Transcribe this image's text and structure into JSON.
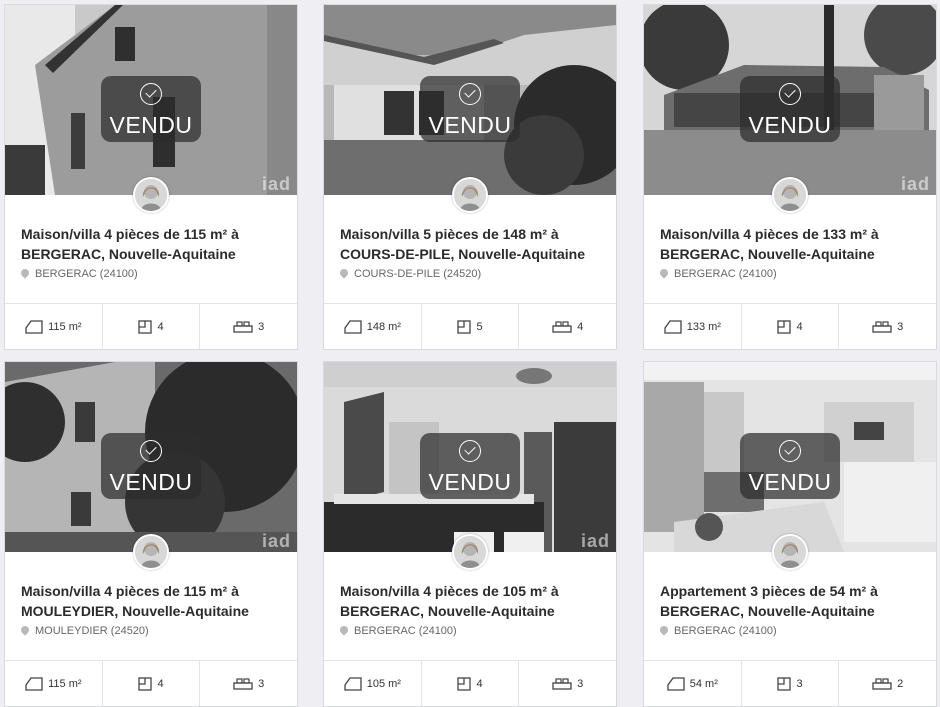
{
  "sold_label": "VENDU",
  "watermark": "iad",
  "listings": [
    {
      "title": "Maison/villa 4 pièces de 115 m² à BERGERAC, Nouvelle-Aquitaine",
      "location": "BERGERAC (24100)",
      "surface": "115 m²",
      "rooms": "4",
      "bedrooms": "3",
      "watermark": "iad"
    },
    {
      "title": "Maison/villa 5 pièces de 148 m² à COURS-DE-PILE, Nouvelle-Aquitaine",
      "location": "COURS-DE-PILE (24520)",
      "surface": "148 m²",
      "rooms": "5",
      "bedrooms": "4",
      "watermark": ""
    },
    {
      "title": "Maison/villa 4 pièces de 133 m² à BERGERAC, Nouvelle-Aquitaine",
      "location": "BERGERAC (24100)",
      "surface": "133 m²",
      "rooms": "4",
      "bedrooms": "3",
      "watermark": "iad"
    },
    {
      "title": "Maison/villa 4 pièces de 115 m² à MOULEYDIER, Nouvelle-Aquitaine",
      "location": "MOULEYDIER (24520)",
      "surface": "115 m²",
      "rooms": "4",
      "bedrooms": "3",
      "watermark": "iad"
    },
    {
      "title": "Maison/villa 4 pièces de 105 m² à BERGERAC, Nouvelle-Aquitaine",
      "location": "BERGERAC (24100)",
      "surface": "105 m²",
      "rooms": "4",
      "bedrooms": "3",
      "watermark": "iad"
    },
    {
      "title": "Appartement 3 pièces de 54 m² à BERGERAC, Nouvelle-Aquitaine",
      "location": "BERGERAC (24100)",
      "surface": "54 m²",
      "rooms": "3",
      "bedrooms": "2",
      "watermark": ""
    }
  ]
}
